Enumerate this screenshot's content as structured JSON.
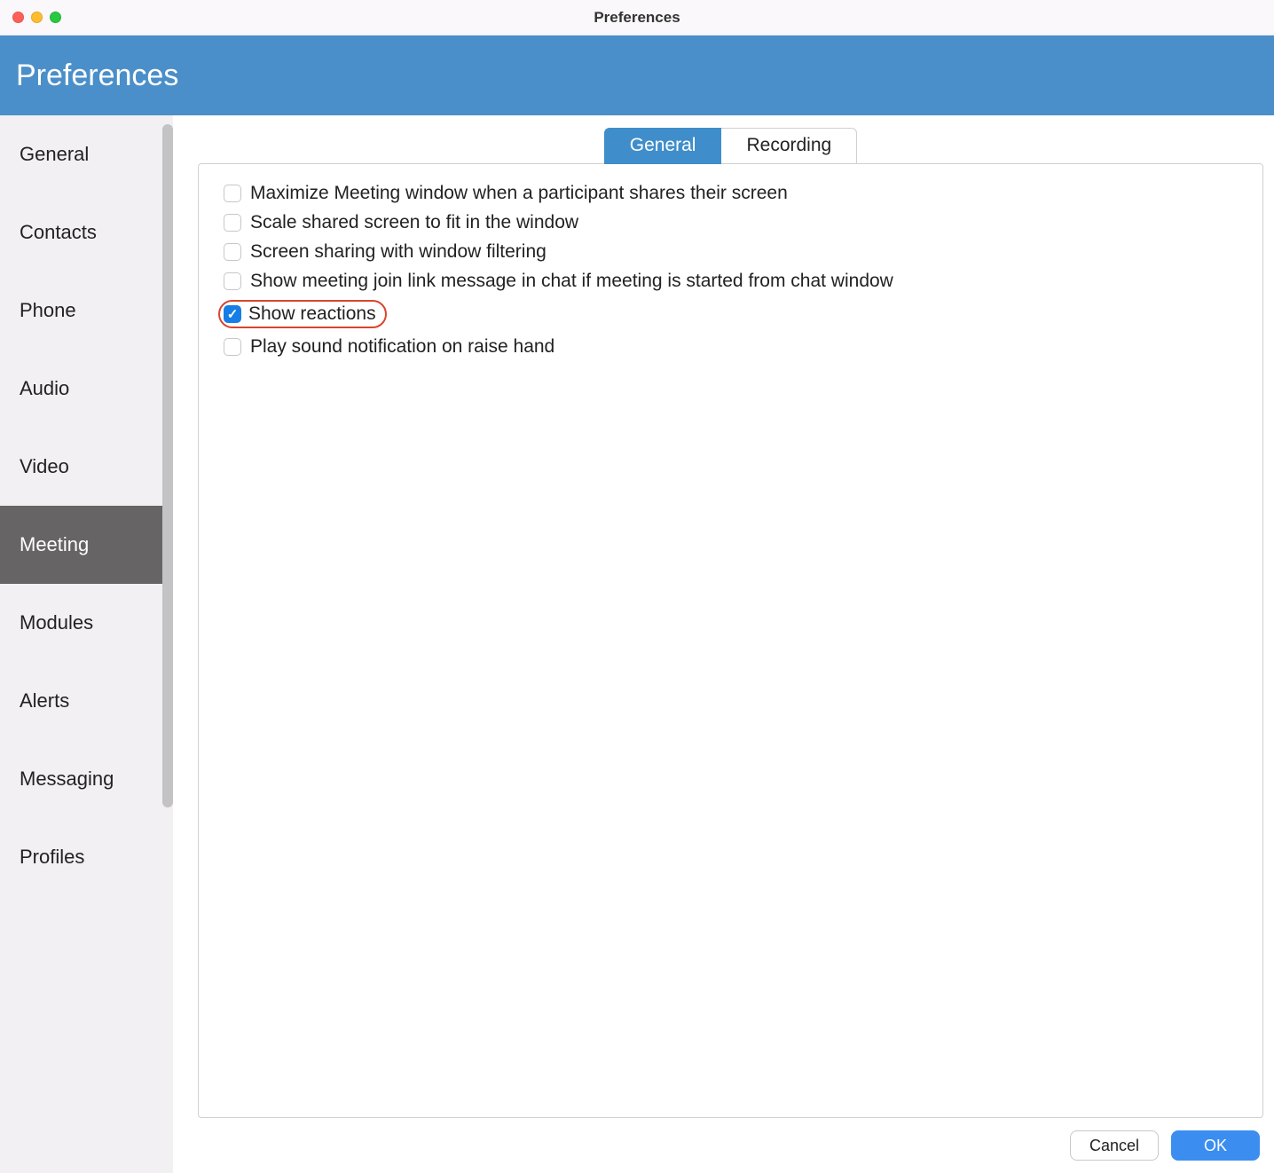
{
  "window": {
    "title": "Preferences"
  },
  "banner": {
    "title": "Preferences"
  },
  "sidebar": {
    "items": [
      {
        "label": "General",
        "active": false
      },
      {
        "label": "Contacts",
        "active": false
      },
      {
        "label": "Phone",
        "active": false
      },
      {
        "label": "Audio",
        "active": false
      },
      {
        "label": "Video",
        "active": false
      },
      {
        "label": "Meeting",
        "active": true
      },
      {
        "label": "Modules",
        "active": false
      },
      {
        "label": "Alerts",
        "active": false
      },
      {
        "label": "Messaging",
        "active": false
      },
      {
        "label": "Profiles",
        "active": false
      }
    ]
  },
  "tabs": [
    {
      "label": "General",
      "active": true
    },
    {
      "label": "Recording",
      "active": false
    }
  ],
  "options": [
    {
      "label": "Maximize Meeting window when a participant shares their screen",
      "checked": false,
      "highlighted": false
    },
    {
      "label": "Scale shared screen to fit in the window",
      "checked": false,
      "highlighted": false
    },
    {
      "label": "Screen sharing with window filtering",
      "checked": false,
      "highlighted": false
    },
    {
      "label": "Show meeting join link message in chat if meeting is started from chat window",
      "checked": false,
      "highlighted": false
    },
    {
      "label": "Show reactions",
      "checked": true,
      "highlighted": true
    },
    {
      "label": "Play sound notification on raise hand",
      "checked": false,
      "highlighted": false
    }
  ],
  "footer": {
    "cancel": "Cancel",
    "ok": "OK"
  }
}
